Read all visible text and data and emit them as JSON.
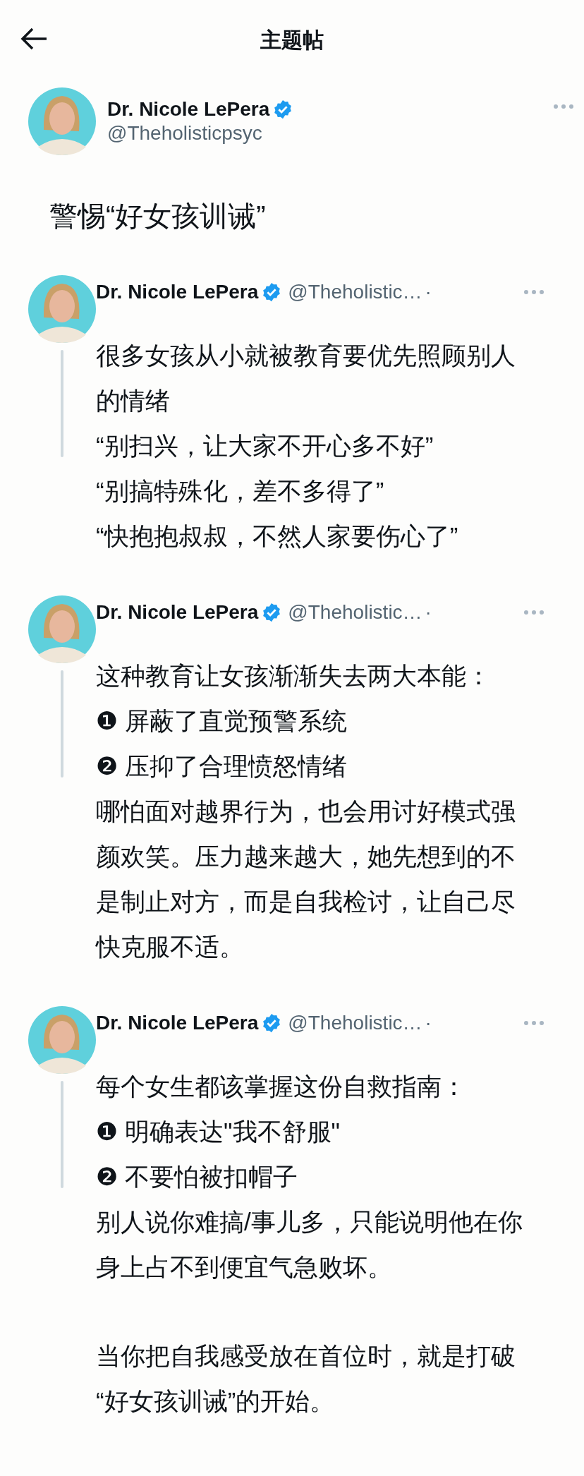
{
  "header": {
    "title": "主题帖"
  },
  "author": {
    "name": "Dr. Nicole LePera",
    "verified": true,
    "handle": "@Theholisticpsyc"
  },
  "post_title": "警惕“好女孩训诫”",
  "tweets": [
    {
      "name": "Dr. Nicole LePera",
      "verified": true,
      "handle": "@Theholistic…",
      "separator": "·",
      "blocks": [
        [
          "很多女孩从小就被教育要优先照顾别人",
          "的情绪",
          "“别扫兴，让大家不开心多不好”",
          "“别搞特殊化，差不多得了”",
          "“快抱抱叔叔，不然人家要伤心了”"
        ]
      ]
    },
    {
      "name": "Dr. Nicole LePera",
      "verified": true,
      "handle": "@Theholistic…",
      "separator": "·",
      "blocks": [
        [
          "这种教育让女孩渐渐失去两大本能：",
          "❶ 屏蔽了直觉预警系统",
          "❷ 压抑了合理愤怒情绪",
          "哪怕面对越界行为，也会用讨好模式强",
          "颜欢笑。压力越来越大，她先想到的不",
          "是制止对方，而是自我检讨，让自己尽",
          "快克服不适。"
        ]
      ]
    },
    {
      "name": "Dr. Nicole LePera",
      "verified": true,
      "handle": "@Theholistic…",
      "separator": "·",
      "blocks": [
        [
          "每个女生都该掌握这份自救指南：",
          "❶ 明确表达\"我不舒服\"",
          "❷ 不要怕被扣帽子",
          "别人说你难搞/事儿多，只能说明他在你",
          "身上占不到便宜气急败坏。"
        ],
        [
          "当你把自我感受放在首位时，就是打破",
          "“好女孩训诫”的开始。"
        ]
      ]
    }
  ]
}
